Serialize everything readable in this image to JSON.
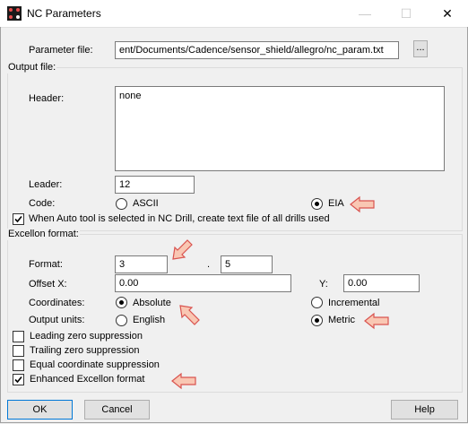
{
  "window": {
    "title": "NC Parameters",
    "minimize": "—",
    "maximize": "☐",
    "close": "✕"
  },
  "parameter_file": {
    "label": "Parameter file:",
    "value": "ent/Documents/Cadence/sensor_shield/allegro/nc_param.txt",
    "browse_label": "..."
  },
  "output_file": {
    "group_label": "Output file:",
    "header_label": "Header:",
    "header_value": "none",
    "leader_label": "Leader:",
    "leader_value": "12",
    "code_label": "Code:",
    "ascii_label": "ASCII",
    "eia_label": "EIA",
    "code_selected": "EIA",
    "auto_tool_label": "When Auto tool is selected in NC Drill, create text file of all drills used",
    "auto_tool_checked": true
  },
  "excellon": {
    "group_label": "Excellon format:",
    "format_label": "Format:",
    "format_int": "3",
    "format_sep": ".",
    "format_dec": "5",
    "offset_x_label": "Offset X:",
    "offset_x_value": "0.00",
    "offset_y_label": "Y:",
    "offset_y_value": "0.00",
    "coordinates_label": "Coordinates:",
    "absolute_label": "Absolute",
    "incremental_label": "Incremental",
    "coordinates_selected": "Absolute",
    "units_label": "Output units:",
    "english_label": "English",
    "metric_label": "Metric",
    "units_selected": "Metric",
    "leading_zero_label": "Leading zero suppression",
    "leading_zero_checked": false,
    "trailing_zero_label": "Trailing zero suppression",
    "trailing_zero_checked": false,
    "equal_coord_label": "Equal coordinate suppression",
    "equal_coord_checked": false,
    "enhanced_label": "Enhanced Excellon format",
    "enhanced_checked": true
  },
  "buttons": {
    "ok": "OK",
    "cancel": "Cancel",
    "help": "Help"
  },
  "colors": {
    "annotation_arrow_fill": "#f9c7b3",
    "annotation_arrow_stroke": "#d9534f",
    "accent": "#0078d7"
  }
}
